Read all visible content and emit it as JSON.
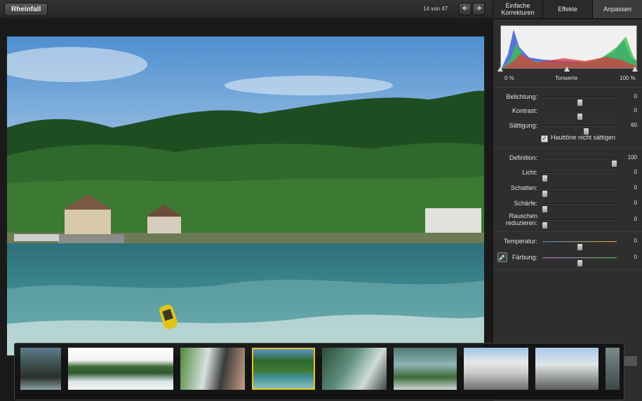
{
  "app": {
    "album": "Rheinfall",
    "counter": "14 von 47"
  },
  "tabs": [
    {
      "label": "Einfache Korrekturen"
    },
    {
      "label": "Effekte"
    },
    {
      "label": "Anpassen"
    }
  ],
  "histogram": {
    "left_label": "0 %",
    "center_label": "Tonwerte",
    "right_label": "100 %"
  },
  "adjust": {
    "exposure": {
      "label": "Belichtung:",
      "value": "0",
      "level": 0.5
    },
    "contrast": {
      "label": "Kontrast:",
      "value": "0",
      "level": 0.5
    },
    "saturation": {
      "label": "Sättigung:",
      "value": "60",
      "level": 0.6
    },
    "skin_tones": {
      "label": "Hauttöne nicht sättigen",
      "checked": true
    },
    "definition": {
      "label": "Definition:",
      "value": "100",
      "level": 1.0
    },
    "highlights": {
      "label": "Licht:",
      "value": "0",
      "level": 0
    },
    "shadows": {
      "label": "Schatten:",
      "value": "0",
      "level": 0
    },
    "sharpness": {
      "label": "Schärfe:",
      "value": "0",
      "level": 0
    },
    "noise": {
      "label_line1": "Rauschen",
      "label_line2": "reduzieren:",
      "value": "0",
      "level": 0
    },
    "temperature": {
      "label": "Temperatur:",
      "value": "0",
      "level": 0.5
    },
    "tint": {
      "label": "Färbung:",
      "value": "0",
      "level": 0.5
    }
  },
  "icons": {
    "back": "back-button",
    "prev": "arrow-left-icon",
    "next": "arrow-right-icon",
    "pipette": "eyedropper-icon",
    "checkbox": "checkmark-icon"
  },
  "colors": {
    "selected_thumb": "#e8c21c",
    "temp_start": "#4a7fd6",
    "temp_end": "#e6a11a",
    "tint_start": "#c55bd6",
    "tint_end": "#3fbf4f"
  }
}
